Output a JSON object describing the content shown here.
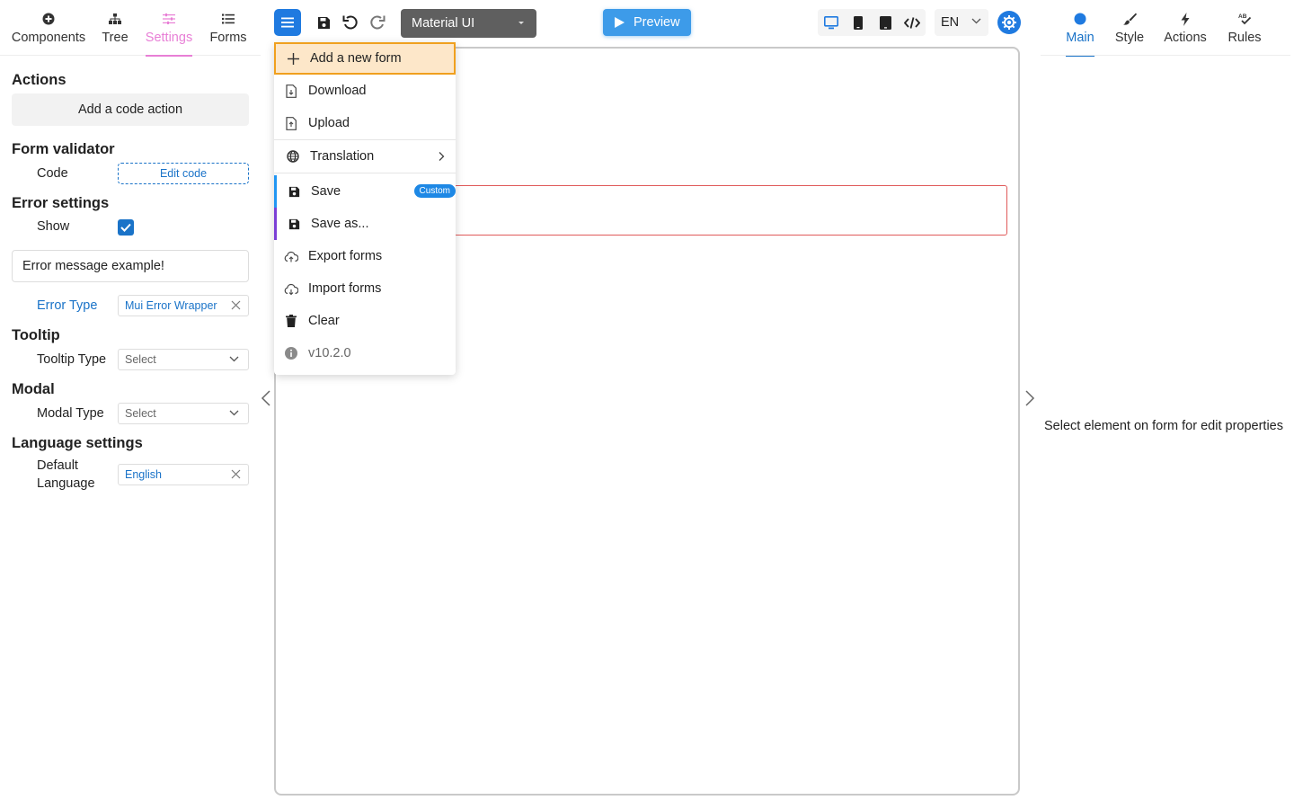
{
  "left_tabs": [
    {
      "label": "Components",
      "icon": "plus-circle-icon"
    },
    {
      "label": "Tree",
      "icon": "tree-icon"
    },
    {
      "label": "Settings",
      "icon": "sliders-icon",
      "active": true
    },
    {
      "label": "Forms",
      "icon": "list-icon"
    }
  ],
  "settings": {
    "actions_title": "Actions",
    "add_code_action": "Add a code action",
    "validator_title": "Form validator",
    "code_label": "Code",
    "edit_code": "Edit code",
    "error_settings_title": "Error settings",
    "show_label": "Show",
    "show_checked": true,
    "error_message": "Error message example!",
    "error_type_label": "Error Type",
    "error_type_value": "Mui Error Wrapper",
    "tooltip_title": "Tooltip",
    "tooltip_type_label": "Tooltip Type",
    "tooltip_type_placeholder": "Select",
    "modal_title": "Modal",
    "modal_type_label": "Modal Type",
    "modal_type_placeholder": "Select",
    "language_title": "Language settings",
    "default_language_label_1": "Default",
    "default_language_label_2": "Language",
    "default_language_value": "English"
  },
  "toolbar": {
    "theme_value": "Material UI",
    "preview_label": "Preview",
    "language_value": "EN"
  },
  "menu": {
    "items": [
      {
        "label": "Add a new form",
        "icon": "plus-icon"
      },
      {
        "label": "Download",
        "icon": "download-file-icon"
      },
      {
        "label": "Upload",
        "icon": "upload-file-icon"
      },
      {
        "label": "Translation",
        "icon": "globe-icon"
      },
      {
        "label": "Save",
        "icon": "floppy-icon",
        "badge": "Custom"
      },
      {
        "label": "Save as...",
        "icon": "floppy-icon"
      },
      {
        "label": "Export forms",
        "icon": "cloud-upload-icon"
      },
      {
        "label": "Import forms",
        "icon": "cloud-download-icon"
      },
      {
        "label": "Clear",
        "icon": "trash-icon"
      },
      {
        "label": "v10.2.0",
        "icon": "info-icon"
      }
    ]
  },
  "right_tabs": [
    {
      "label": "Main",
      "icon": "circle-icon",
      "active": true
    },
    {
      "label": "Style",
      "icon": "brush-icon"
    },
    {
      "label": "Actions",
      "icon": "bolt-icon"
    },
    {
      "label": "Rules",
      "icon": "spellcheck-icon"
    }
  ],
  "right_panel": {
    "hint": "Select element on form for edit properties"
  },
  "colors": {
    "accent_blue": "#1f7ae0",
    "settings_pink": "#e87fd6",
    "highlight_orange": "#f0a01e",
    "error_red": "#e05a5a"
  }
}
